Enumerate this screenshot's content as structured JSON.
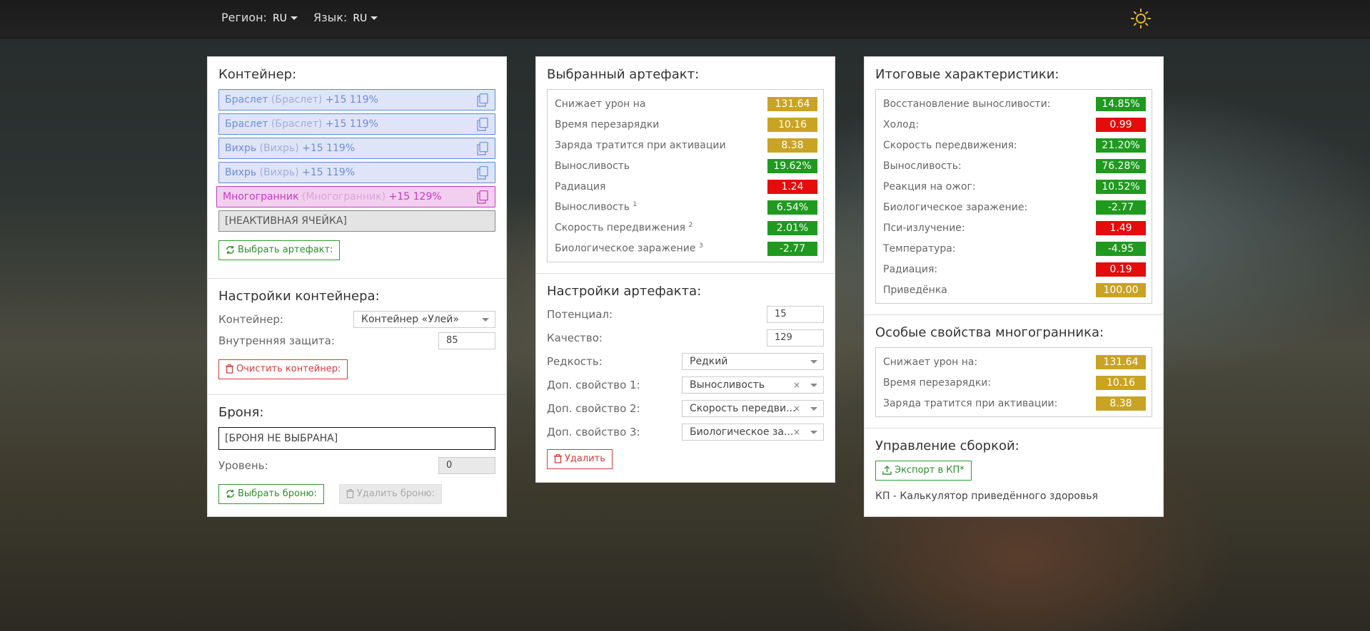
{
  "topbar": {
    "region_label": "Регион:",
    "region_value": "RU",
    "language_label": "Язык:",
    "language_value": "RU"
  },
  "container": {
    "title": "Контейнер:",
    "slots": [
      {
        "name": "Браслет",
        "sub": "(Браслет)",
        "bonus": "+15 119%"
      },
      {
        "name": "Браслет",
        "sub": "(Браслет)",
        "bonus": "+15 119%"
      },
      {
        "name": "Вихрь",
        "sub": "(Вихрь)",
        "bonus": "+15 119%"
      },
      {
        "name": "Вихрь",
        "sub": "(Вихрь)",
        "bonus": "+15 119%"
      },
      {
        "name": "Многогранник",
        "sub": "(Многогранник)",
        "bonus": "+15 129%"
      }
    ],
    "inactive_slot": "[НЕАКТИВНАЯ ЯЧЕЙКА]",
    "select_artifact_button": "Выбрать артефакт:"
  },
  "container_settings": {
    "title": "Настройки контейнера:",
    "container_label": "Контейнер:",
    "container_value": "Контейнер «Улей»",
    "protection_label": "Внутренняя защита:",
    "protection_value": "85",
    "clear_button": "Очистить контейнер:"
  },
  "armor": {
    "title": "Броня:",
    "value": "[БРОНЯ НЕ ВЫБРАНА]",
    "level_label": "Уровень:",
    "level_value": "0",
    "select_button": "Выбрать броню:",
    "delete_button": "Удалить броню:"
  },
  "selected_artifact": {
    "title": "Выбранный артефакт:",
    "stats": [
      {
        "label": "Снижает урон на",
        "sup": "",
        "value": "131.64",
        "color": "yellow"
      },
      {
        "label": "Время перезарядки",
        "sup": "",
        "value": "10.16",
        "color": "yellow"
      },
      {
        "label": "Заряда тратится при активации",
        "sup": "",
        "value": "8.38",
        "color": "yellow"
      },
      {
        "label": "Выносливость",
        "sup": "",
        "value": "19.62%",
        "color": "green"
      },
      {
        "label": "Радиация",
        "sup": "",
        "value": "1.24",
        "color": "red"
      },
      {
        "label": "Выносливость",
        "sup": "1",
        "value": "6.54%",
        "color": "green"
      },
      {
        "label": "Скорость передвижения",
        "sup": "2",
        "value": "2.01%",
        "color": "green"
      },
      {
        "label": "Биологическое заражение",
        "sup": "3",
        "value": "-2.77",
        "color": "green"
      }
    ]
  },
  "artifact_settings": {
    "title": "Настройки артефакта:",
    "potential_label": "Потенциал:",
    "potential_value": "15",
    "quality_label": "Качество:",
    "quality_value": "129",
    "rarity_label": "Редкость:",
    "rarity_value": "Редкий",
    "extra1_label": "Доп. свойство 1:",
    "extra1_value": "Выносливость",
    "extra2_label": "Доп. свойство 2:",
    "extra2_value": "Скорость передви...",
    "extra3_label": "Доп. свойство 3:",
    "extra3_value": "Биологическое за...",
    "clear_mark": "×",
    "delete_button": "Удалить"
  },
  "totals": {
    "title": "Итоговые характеристики:",
    "stats": [
      {
        "label": "Восстановление выносливости:",
        "value": "14.85%",
        "color": "green"
      },
      {
        "label": "Холод:",
        "value": "0.99",
        "color": "red"
      },
      {
        "label": "Скорость передвижения:",
        "value": "21.20%",
        "color": "green"
      },
      {
        "label": "Выносливость:",
        "value": "76.28%",
        "color": "green"
      },
      {
        "label": "Реакция на ожог:",
        "value": "10.52%",
        "color": "green"
      },
      {
        "label": "Биологическое заражение:",
        "value": "-2.77",
        "color": "green"
      },
      {
        "label": "Пси-излучение:",
        "value": "1.49",
        "color": "red"
      },
      {
        "label": "Температура:",
        "value": "-4.95",
        "color": "green"
      },
      {
        "label": "Радиация:",
        "value": "0.19",
        "color": "red"
      },
      {
        "label": "Приведёнка",
        "value": "100.00",
        "color": "yellow"
      }
    ]
  },
  "polyhedron": {
    "title": "Особые свойства многогранника:",
    "stats": [
      {
        "label": "Снижает урон на:",
        "value": "131.64",
        "color": "yellow"
      },
      {
        "label": "Время перезарядки:",
        "value": "10.16",
        "color": "yellow"
      },
      {
        "label": "Заряда тратится при активации:",
        "value": "8.38",
        "color": "yellow"
      }
    ]
  },
  "build": {
    "title": "Управление сборкой:",
    "export_button": "Экспорт в КП*",
    "note": "КП - Калькулятор приведённого здоровья"
  },
  "colors": {
    "yellow": "#c9a424",
    "green": "#1f9a1f",
    "red": "#e50c0c"
  }
}
